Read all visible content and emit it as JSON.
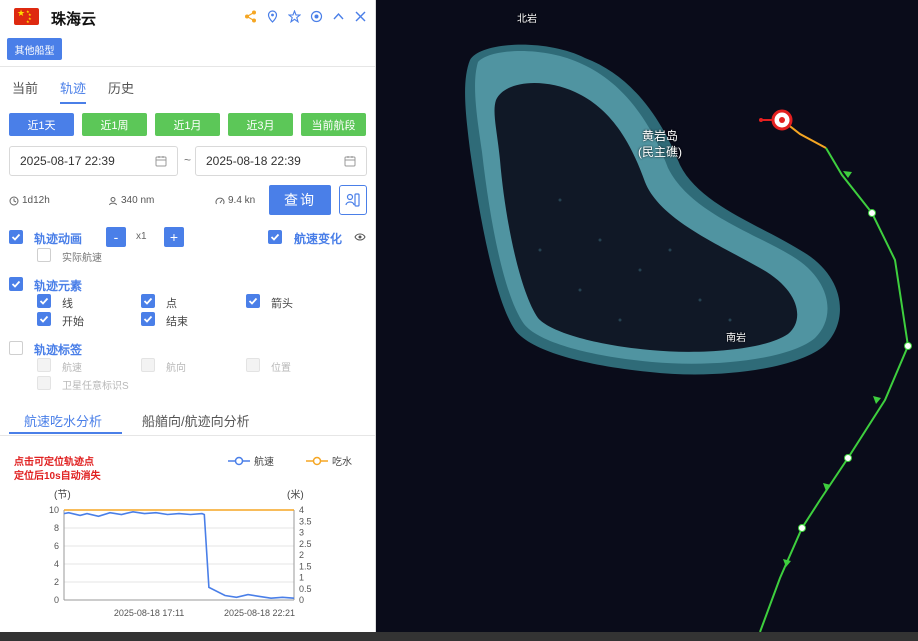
{
  "ship": {
    "name": "珠海云"
  },
  "header": {
    "icons": [
      "share-icon",
      "location-icon",
      "star-icon",
      "target-icon",
      "collapse-icon",
      "close-icon"
    ]
  },
  "other_fleet_label": "其他船型",
  "main_tabs": [
    {
      "label": "当前",
      "active": false
    },
    {
      "label": "轨迹",
      "active": true
    },
    {
      "label": "历史",
      "active": false
    }
  ],
  "range_buttons": [
    {
      "label": "近1天",
      "active": true
    },
    {
      "label": "近1周",
      "active": false
    },
    {
      "label": "近1月",
      "active": false
    },
    {
      "label": "近3月",
      "active": false
    },
    {
      "label": "当前航段",
      "active": false
    }
  ],
  "date_range": {
    "start": "2025-08-17 22:39",
    "separator": "~",
    "end": "2025-08-18 22:39"
  },
  "stats": {
    "duration": "1d12h",
    "distance": "340 nm",
    "speed": "9.4 kn"
  },
  "query_label": "查询",
  "track_animation": {
    "label": "轨迹动画",
    "checked": true,
    "speed_multiplier": "x1",
    "minus": "-",
    "plus": "+",
    "real_speed_label": "实际航速",
    "real_speed_checked": false
  },
  "speed_change": {
    "label": "航速变化",
    "checked": true
  },
  "track_elements": {
    "label": "轨迹元素",
    "checked": true,
    "items": [
      {
        "label": "线",
        "checked": true
      },
      {
        "label": "点",
        "checked": true
      },
      {
        "label": "箭头",
        "checked": true
      },
      {
        "label": "开始",
        "checked": true
      },
      {
        "label": "结束",
        "checked": true
      }
    ]
  },
  "track_labels": {
    "label": "轨迹标签",
    "checked": false,
    "items": [
      {
        "label": "航速"
      },
      {
        "label": "航向"
      },
      {
        "label": "位置"
      },
      {
        "label": "卫星任意标识S"
      }
    ]
  },
  "analysis_tabs": [
    {
      "label": "航速吃水分析",
      "active": true
    },
    {
      "label": "船艏向/航迹向分析",
      "active": false
    }
  ],
  "hint": {
    "line1": "点击可定位轨迹点",
    "line2": "定位后10s自动消失"
  },
  "legend": {
    "speed": "航速",
    "draft": "吃水",
    "speed_color": "#4a7fe8",
    "draft_color": "#f5a623"
  },
  "units": {
    "left": "(节)",
    "right": "(米)"
  },
  "chart_data": {
    "type": "line",
    "x_ticks": [
      "2025-08-18 17:11",
      "2025-08-18 22:21"
    ],
    "y_left": {
      "label": "(节)",
      "ticks": [
        0,
        2,
        4,
        6,
        8,
        10
      ],
      "range": [
        0,
        10
      ]
    },
    "y_right": {
      "label": "(米)",
      "ticks": [
        0,
        0.5,
        1,
        1.5,
        2,
        2.5,
        3,
        3.5,
        4
      ],
      "range": [
        0,
        4
      ]
    },
    "series": [
      {
        "name": "航速",
        "color": "#4a7fe8",
        "axis": "left",
        "x": [
          0,
          0.02,
          0.07,
          0.1,
          0.15,
          0.2,
          0.25,
          0.3,
          0.35,
          0.4,
          0.45,
          0.5,
          0.55,
          0.6,
          0.61,
          0.63,
          0.7,
          0.75,
          0.8,
          0.85,
          0.9,
          0.95,
          1.0
        ],
        "values": [
          9.6,
          9.7,
          9.4,
          9.6,
          9.3,
          9.7,
          9.5,
          9.8,
          9.6,
          9.7,
          9.5,
          9.6,
          9.5,
          9.6,
          9.5,
          1.4,
          0.5,
          0.3,
          0.6,
          0.4,
          0.2,
          0.3,
          0.2
        ]
      },
      {
        "name": "吃水",
        "color": "#f5a623",
        "axis": "right",
        "x": [
          0,
          1.0
        ],
        "values": [
          4,
          4
        ]
      }
    ]
  },
  "map": {
    "labels": {
      "north_rock": "北岩",
      "south_rock": "南岩",
      "island_name": "黄岩岛",
      "island_alt": "(民主礁)"
    }
  }
}
